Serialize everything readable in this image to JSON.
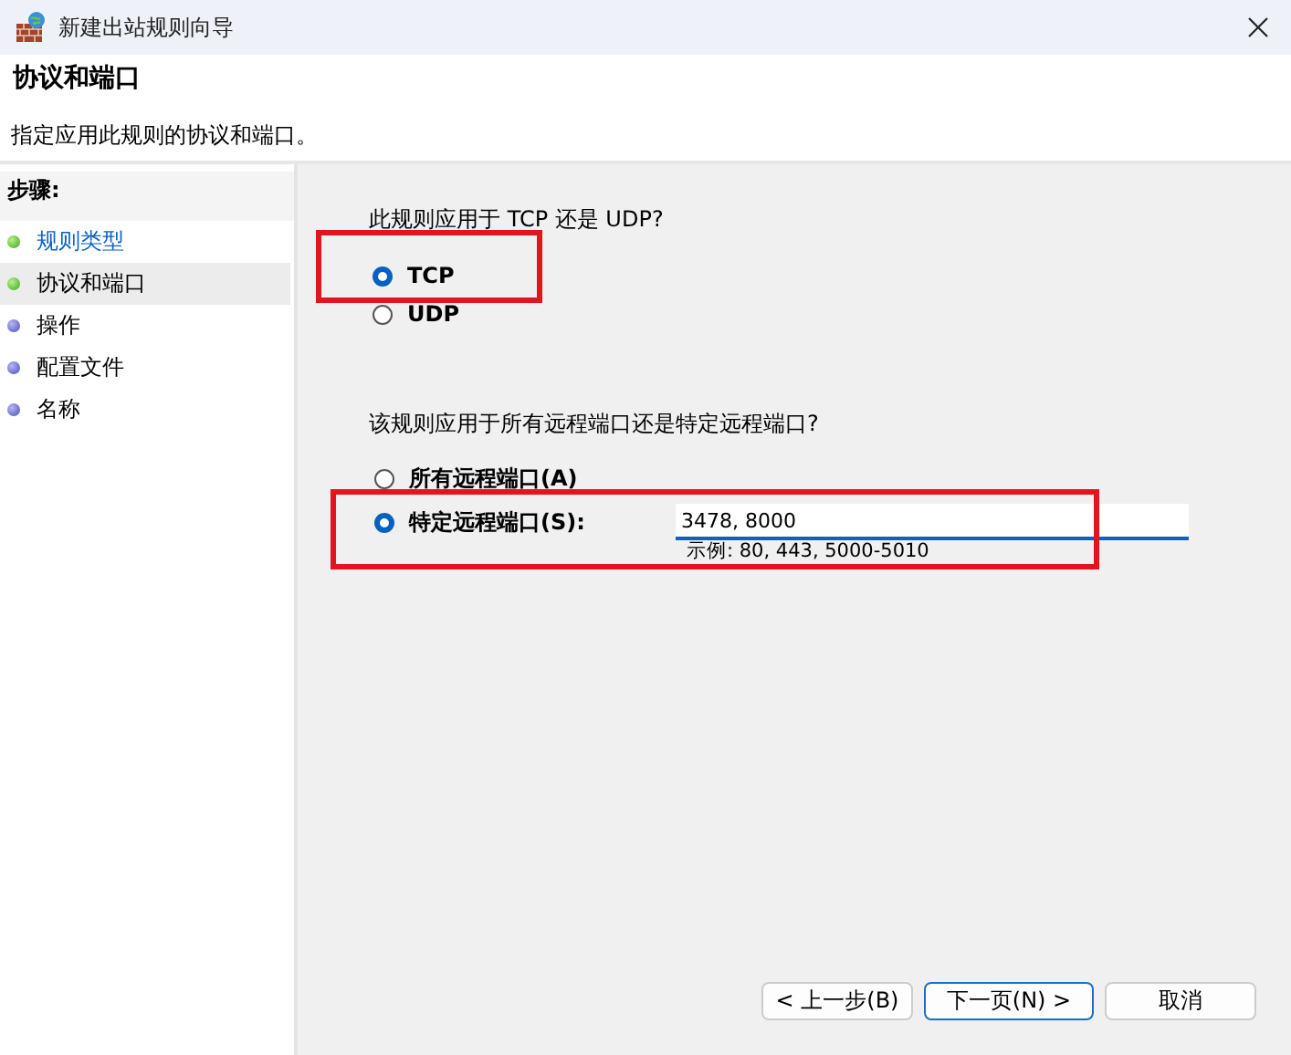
{
  "window": {
    "title": "新建出站规则向导"
  },
  "header": {
    "title": "协议和端口",
    "subtitle": "指定应用此规则的协议和端口。"
  },
  "steps": {
    "label": "步骤:",
    "items": [
      {
        "label": "规则类型",
        "selected": false,
        "done": true,
        "link": true
      },
      {
        "label": "协议和端口",
        "selected": true,
        "done": true,
        "link": false
      },
      {
        "label": "操作",
        "selected": false,
        "done": false,
        "link": false
      },
      {
        "label": "配置文件",
        "selected": false,
        "done": false,
        "link": false
      },
      {
        "label": "名称",
        "selected": false,
        "done": false,
        "link": false
      }
    ]
  },
  "protocol": {
    "question": "此规则应用于 TCP 还是 UDP?",
    "options": [
      {
        "label": "TCP",
        "selected": true
      },
      {
        "label": "UDP",
        "selected": false
      }
    ]
  },
  "ports": {
    "question": "该规则应用于所有远程端口还是特定远程端口?",
    "options": [
      {
        "label": "所有远程端口(A)",
        "selected": false
      },
      {
        "label": "特定远程端口(S):",
        "selected": true
      }
    ],
    "value": "3478, 8000",
    "example": "示例: 80, 443, 5000-5010"
  },
  "buttons": [
    {
      "label": "< 上一步(B)",
      "default": false
    },
    {
      "label": "下一页(N) >",
      "default": true
    },
    {
      "label": "取消",
      "default": false
    }
  ]
}
